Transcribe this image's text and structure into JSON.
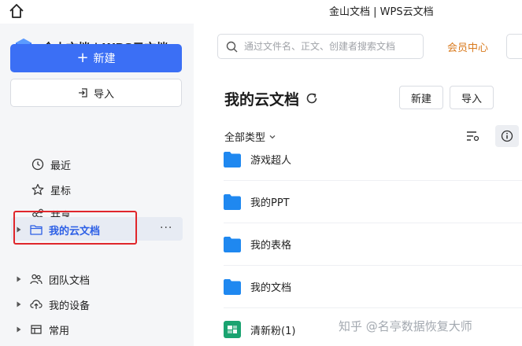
{
  "window": {
    "title": "金山文档 | WPS云文档"
  },
  "brand": {
    "name": "金山文档 | WPS云文档"
  },
  "sidebar": {
    "new_label": "新建",
    "import_label": "导入",
    "nav": [
      {
        "label": "最近",
        "icon": "clock-icon"
      },
      {
        "label": "星标",
        "icon": "star-icon"
      },
      {
        "label": "共享",
        "icon": "share-icon"
      }
    ],
    "tree": [
      {
        "label": "我的云文档",
        "icon": "folder-icon",
        "active": true
      },
      {
        "label": "团队文档",
        "icon": "team-icon"
      },
      {
        "label": "我的设备",
        "icon": "cloud-device-icon"
      },
      {
        "label": "常用",
        "icon": "common-icon"
      }
    ],
    "more": "···"
  },
  "header": {
    "search_placeholder": "通过文件名、正文、创建者搜索文档",
    "vip_label": "会员中心"
  },
  "main": {
    "title": "我的云文档",
    "new_label": "新建",
    "import_label": "导入",
    "filter_label": "全部类型",
    "files": [
      {
        "name": "游戏超人",
        "type": "folder"
      },
      {
        "name": "我的PPT",
        "type": "folder"
      },
      {
        "name": "我的表格",
        "type": "folder"
      },
      {
        "name": "我的文档",
        "type": "folder"
      },
      {
        "name": "清新粉(1)",
        "type": "sheet"
      }
    ]
  },
  "watermark": "知乎 @名亭数据恢复大师",
  "colors": {
    "accent": "#3b6ff5",
    "folder": "#1f88f0",
    "highlight_box": "#e0262b",
    "vip": "#d97a1d"
  }
}
